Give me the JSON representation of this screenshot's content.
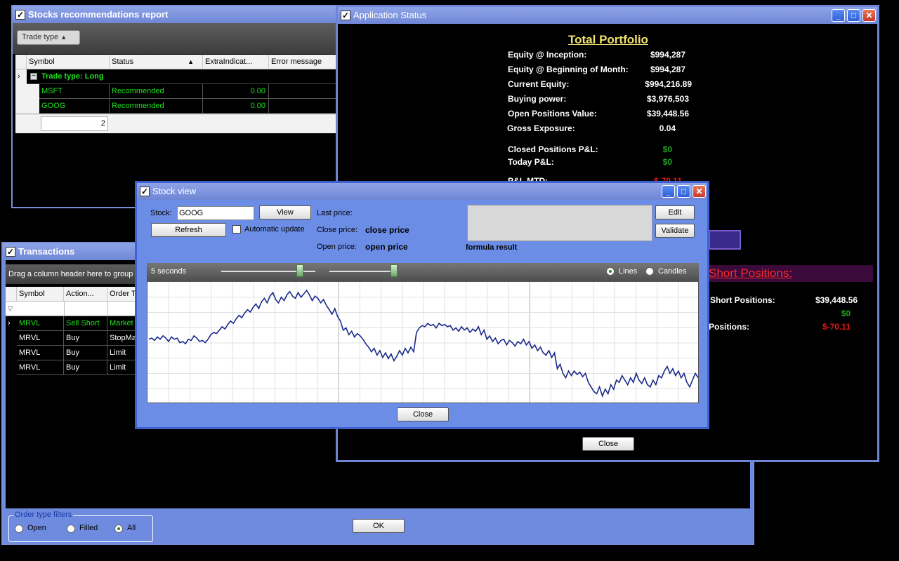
{
  "stocks_window": {
    "title": "Stocks recommendations report",
    "group_chip": "Trade type",
    "group_chip_arrow": "▲",
    "columns": [
      "Symbol",
      "Status",
      "ExtraIndicat...",
      "Error message"
    ],
    "sort_arrow": "▲",
    "group_row": "Trade type: Long",
    "rows": [
      {
        "symbol": "MSFT",
        "status": "Recommended",
        "extra": "0.00",
        "error": ""
      },
      {
        "symbol": "GOOG",
        "status": "Recommended",
        "extra": "0.00",
        "error": ""
      }
    ],
    "summary_count": "2"
  },
  "status_window": {
    "title": "Application Status",
    "heading": "Total Portfolio",
    "items": [
      {
        "label": "Equity @ Inception:",
        "value": "$994,287"
      },
      {
        "label": "Equity @ Beginning of Month:",
        "value": "$994,287"
      },
      {
        "label": "Current Equity:",
        "value": "$994,216.89"
      },
      {
        "label": "Buying power:",
        "value": "$3,976,503"
      },
      {
        "label": "Open Positions Value:",
        "value": "$39,448.56"
      },
      {
        "label": "Gross Exposure:",
        "value": "0.04"
      }
    ],
    "pl_items": [
      {
        "label": "Closed Positions P&L:",
        "value": "$0"
      },
      {
        "label": "Today P&L:",
        "value": "$0"
      }
    ],
    "pl_mtd_label": "P&L MTD:",
    "pl_mtd_value": "$-70.11",
    "short_heading": "Short Positions:",
    "short_items": [
      {
        "label": "Short Positions:",
        "value": "$39,448.56"
      },
      {
        "label": "",
        "value": "$0"
      },
      {
        "label": "Positions:",
        "value": "$-70.11"
      }
    ],
    "close_label": "Close",
    "colors": {
      "green": "#1fa51f",
      "red": "#e01818",
      "heading": "#f0e070",
      "short_heading": "#ff2a2a"
    }
  },
  "transactions_window": {
    "title": "Transactions",
    "group_hint": "Drag a column header here to group b",
    "columns": [
      "Symbol",
      "Action...",
      "Order T"
    ],
    "rows": [
      {
        "symbol": "MRVL",
        "action": "Sell Short",
        "order": "Market"
      },
      {
        "symbol": "MRVL",
        "action": "Buy",
        "order": "StopMar"
      },
      {
        "symbol": "MRVL",
        "action": "Buy",
        "order": "Limit"
      },
      {
        "symbol": "MRVL",
        "action": "Buy",
        "order": "Limit"
      }
    ],
    "filters_title": "Order type filters",
    "filters": [
      {
        "label": "Open",
        "selected": false
      },
      {
        "label": "Filled",
        "selected": false
      },
      {
        "label": "All",
        "selected": true
      }
    ],
    "ok_label": "OK"
  },
  "stock_view": {
    "title": "Stock view",
    "stock_label": "Stock:",
    "stock_value": "GOOG",
    "view_label": "View",
    "refresh_label": "Refresh",
    "auto_update_label": "Automatic update",
    "last_price_label": "Last price:",
    "close_price_label": "Close price:",
    "close_price_value": "close price",
    "open_price_label": "Open price:",
    "open_price_value": "open price",
    "edit_label": "Edit",
    "validate_label": "Validate",
    "formula_result": "formula result",
    "interval_label": "5 seconds",
    "lines_label": "Lines",
    "candles_label": "Candles",
    "close_label": "Close"
  },
  "chart_data": {
    "type": "line",
    "title": "",
    "series": [
      {
        "values": [
          52,
          53,
          51,
          54,
          52,
          55,
          53,
          50,
          54,
          52,
          53,
          49,
          50,
          48,
          52,
          51,
          55,
          53,
          50,
          51,
          49,
          52,
          56,
          58,
          57,
          60,
          63,
          61,
          65,
          68,
          66,
          70,
          73,
          71,
          75,
          78,
          76,
          80,
          83,
          79,
          85,
          88,
          84,
          90,
          93,
          87,
          84,
          89,
          86,
          91,
          94,
          90,
          88,
          93,
          89,
          92,
          95,
          91,
          86,
          90,
          88,
          84,
          87,
          82,
          78,
          74,
          79,
          72,
          68,
          60,
          62,
          56,
          59,
          54,
          57,
          55,
          52,
          48,
          45,
          41,
          44,
          38,
          42,
          36,
          40,
          35,
          39,
          33,
          37,
          42,
          38,
          44,
          40,
          45,
          41,
          58,
          62,
          64,
          63,
          66,
          64,
          65,
          62,
          66,
          64,
          65,
          63,
          64,
          60,
          62,
          59,
          63,
          60,
          62,
          58,
          61,
          59,
          63,
          56,
          60,
          52,
          55,
          50,
          53,
          48,
          51,
          52,
          47,
          51,
          49,
          46,
          50,
          48,
          52,
          47,
          50,
          44,
          47,
          42,
          45,
          40,
          38,
          42,
          36,
          40,
          26,
          30,
          22,
          18,
          24,
          20,
          24,
          21,
          23,
          19,
          22,
          14,
          10,
          6,
          4,
          10,
          2,
          8,
          4,
          12,
          8,
          16,
          14,
          20,
          16,
          12,
          18,
          14,
          22,
          16,
          13,
          18,
          12,
          10,
          16,
          12,
          20,
          18,
          24,
          28,
          22,
          26,
          20,
          24,
          18,
          22,
          14,
          10,
          16,
          22,
          18
        ]
      }
    ],
    "ylim": [
      0,
      100
    ],
    "grid": true
  }
}
